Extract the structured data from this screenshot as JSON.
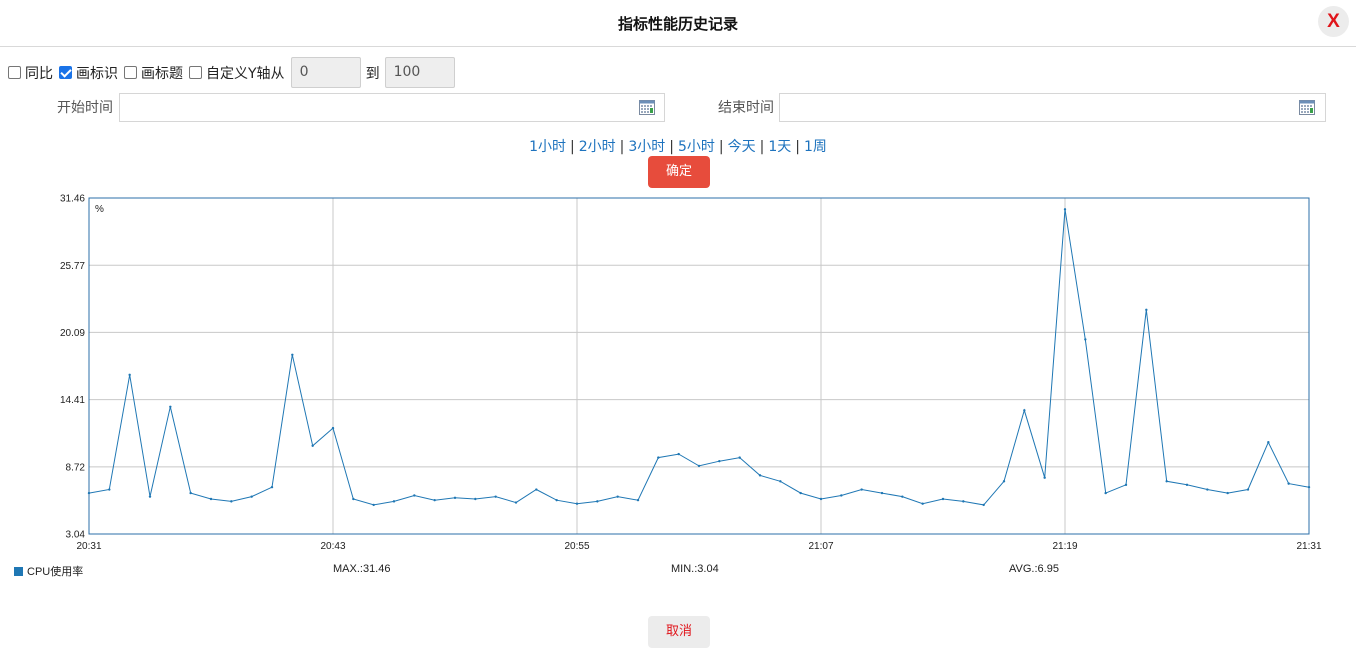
{
  "dialog": {
    "title": "指标性能历史记录",
    "close_label": "X"
  },
  "options": {
    "yoy_label": "同比",
    "yoy_checked": false,
    "draw_marks_label": "画标识",
    "draw_marks_checked": true,
    "draw_title_label": "画标题",
    "draw_title_checked": false,
    "custom_y_label": "自定义Y轴从",
    "custom_y_checked": false,
    "y_from_value": "0",
    "to_label": "到",
    "y_to_value": "100"
  },
  "time": {
    "start_label": "开始时间",
    "start_value": "",
    "end_label": "结束时间",
    "end_value": ""
  },
  "ranges": [
    "1小时",
    "2小时",
    "3小时",
    "5小时",
    "今天",
    "1天",
    "1周"
  ],
  "range_separator": "|",
  "buttons": {
    "ok": "确定",
    "cancel": "取消"
  },
  "colors": {
    "series": "#1f77b4",
    "grid": "#c8c8c8",
    "frame": "#2b6fa8",
    "ok_button": "#e74c3c",
    "close": "#e0151b"
  },
  "stats": {
    "max": "MAX.:31.46",
    "min": "MIN.:3.04",
    "avg": "AVG.:6.95"
  },
  "chart_data": {
    "type": "line",
    "title": "",
    "unit_label": "%",
    "ylim": [
      3.04,
      31.46
    ],
    "yticks": [
      "3.04",
      "8.72",
      "14.41",
      "20.09",
      "25.77",
      "31.46"
    ],
    "xticks": [
      "20:31",
      "20:43",
      "20:55",
      "21:07",
      "21:19",
      "21:31"
    ],
    "grid": true,
    "legend_position": "bottom-left",
    "x": [
      "20:31",
      "20:32",
      "20:33",
      "20:34",
      "20:35",
      "20:36",
      "20:37",
      "20:38",
      "20:39",
      "20:40",
      "20:41",
      "20:42",
      "20:43",
      "20:44",
      "20:45",
      "20:46",
      "20:47",
      "20:48",
      "20:49",
      "20:50",
      "20:51",
      "20:52",
      "20:53",
      "20:54",
      "20:55",
      "20:56",
      "20:57",
      "20:58",
      "20:59",
      "21:00",
      "21:01",
      "21:02",
      "21:03",
      "21:04",
      "21:05",
      "21:06",
      "21:07",
      "21:08",
      "21:09",
      "21:10",
      "21:11",
      "21:12",
      "21:13",
      "21:14",
      "21:15",
      "21:16",
      "21:17",
      "21:18",
      "21:19",
      "21:20",
      "21:21",
      "21:22",
      "21:23",
      "21:24",
      "21:25",
      "21:26",
      "21:27",
      "21:28",
      "21:29",
      "21:30",
      "21:31"
    ],
    "series": [
      {
        "name": "CPU使用率",
        "values": [
          6.5,
          6.8,
          16.5,
          6.2,
          13.8,
          6.5,
          6.0,
          5.8,
          6.2,
          7.0,
          18.2,
          10.5,
          12.0,
          6.0,
          5.5,
          5.8,
          6.3,
          5.9,
          6.1,
          6.0,
          6.2,
          5.7,
          6.8,
          5.9,
          5.6,
          5.8,
          6.2,
          5.9,
          9.5,
          9.8,
          8.8,
          9.2,
          9.5,
          8.0,
          7.5,
          6.5,
          6.0,
          6.3,
          6.8,
          6.5,
          6.2,
          5.6,
          6.0,
          5.8,
          5.5,
          7.5,
          13.5,
          7.8,
          30.5,
          19.5,
          6.5,
          7.2,
          22.0,
          7.5,
          7.2,
          6.8,
          6.5,
          6.8,
          10.8,
          7.3,
          7.0
        ]
      }
    ]
  }
}
